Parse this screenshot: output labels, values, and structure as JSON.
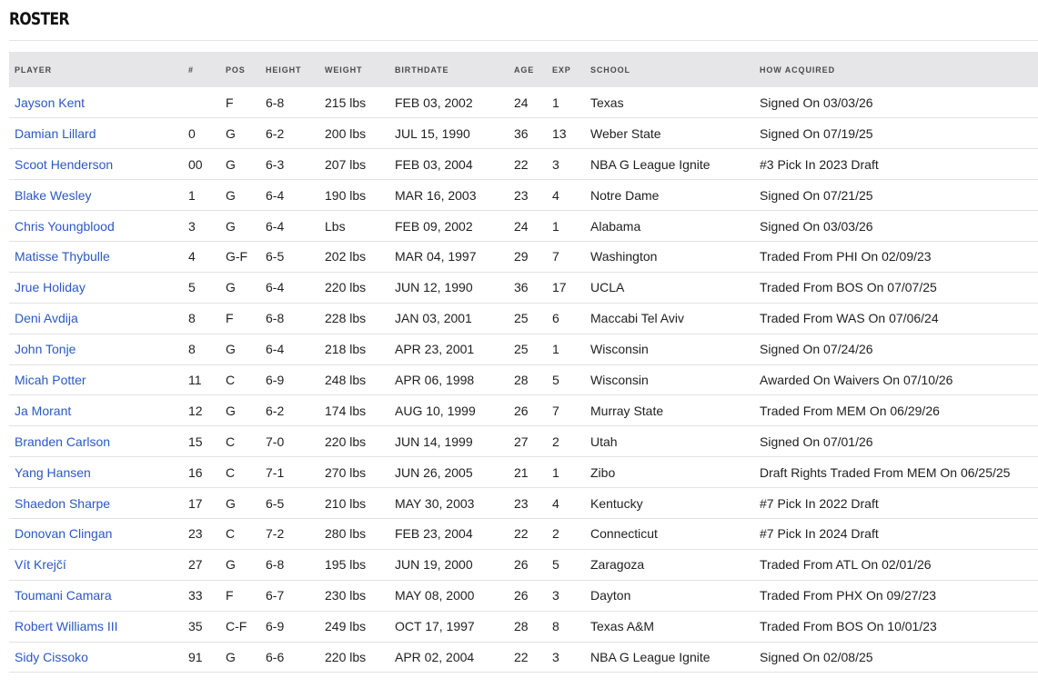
{
  "title": "ROSTER",
  "columns": {
    "player": "PLAYER",
    "number": "#",
    "pos": "POS",
    "height": "HEIGHT",
    "weight": "WEIGHT",
    "birthdate": "BIRTHDATE",
    "age": "AGE",
    "exp": "EXP",
    "school": "SCHOOL",
    "acquired": "HOW ACQUIRED"
  },
  "colors": {
    "link": "#2b58c5",
    "header_bg": "#e6e6e9",
    "divider": "#e3e3e3"
  },
  "rows": [
    {
      "player": "Jayson Kent",
      "number": "",
      "pos": "F",
      "height": "6-8",
      "weight": "215 lbs",
      "birthdate": "FEB 03, 2002",
      "age": "24",
      "exp": "1",
      "school": "Texas",
      "acquired": "Signed On 03/03/26"
    },
    {
      "player": "Damian Lillard",
      "number": "0",
      "pos": "G",
      "height": "6-2",
      "weight": "200 lbs",
      "birthdate": "JUL 15, 1990",
      "age": "36",
      "exp": "13",
      "school": "Weber State",
      "acquired": "Signed On 07/19/25"
    },
    {
      "player": "Scoot Henderson",
      "number": "00",
      "pos": "G",
      "height": "6-3",
      "weight": "207 lbs",
      "birthdate": "FEB 03, 2004",
      "age": "22",
      "exp": "3",
      "school": "NBA G League Ignite",
      "acquired": "#3 Pick In 2023 Draft"
    },
    {
      "player": "Blake Wesley",
      "number": "1",
      "pos": "G",
      "height": "6-4",
      "weight": "190 lbs",
      "birthdate": "MAR 16, 2003",
      "age": "23",
      "exp": "4",
      "school": "Notre Dame",
      "acquired": "Signed On 07/21/25"
    },
    {
      "player": "Chris Youngblood",
      "number": "3",
      "pos": "G",
      "height": "6-4",
      "weight": "Lbs",
      "birthdate": "FEB 09, 2002",
      "age": "24",
      "exp": "1",
      "school": "Alabama",
      "acquired": "Signed On 03/03/26"
    },
    {
      "player": "Matisse Thybulle",
      "number": "4",
      "pos": "G-F",
      "height": "6-5",
      "weight": "202 lbs",
      "birthdate": "MAR 04, 1997",
      "age": "29",
      "exp": "7",
      "school": "Washington",
      "acquired": "Traded From PHI On 02/09/23"
    },
    {
      "player": "Jrue Holiday",
      "number": "5",
      "pos": "G",
      "height": "6-4",
      "weight": "220 lbs",
      "birthdate": "JUN 12, 1990",
      "age": "36",
      "exp": "17",
      "school": "UCLA",
      "acquired": "Traded From BOS On 07/07/25"
    },
    {
      "player": "Deni Avdija",
      "number": "8",
      "pos": "F",
      "height": "6-8",
      "weight": "228 lbs",
      "birthdate": "JAN 03, 2001",
      "age": "25",
      "exp": "6",
      "school": "Maccabi Tel Aviv",
      "acquired": "Traded From WAS On 07/06/24"
    },
    {
      "player": "John Tonje",
      "number": "8",
      "pos": "G",
      "height": "6-4",
      "weight": "218 lbs",
      "birthdate": "APR 23, 2001",
      "age": "25",
      "exp": "1",
      "school": "Wisconsin",
      "acquired": "Signed On 07/24/26"
    },
    {
      "player": "Micah Potter",
      "number": "11",
      "pos": "C",
      "height": "6-9",
      "weight": "248 lbs",
      "birthdate": "APR 06, 1998",
      "age": "28",
      "exp": "5",
      "school": "Wisconsin",
      "acquired": "Awarded On Waivers On 07/10/26"
    },
    {
      "player": "Ja Morant",
      "number": "12",
      "pos": "G",
      "height": "6-2",
      "weight": "174 lbs",
      "birthdate": "AUG 10, 1999",
      "age": "26",
      "exp": "7",
      "school": "Murray State",
      "acquired": "Traded From MEM On 06/29/26"
    },
    {
      "player": "Branden Carlson",
      "number": "15",
      "pos": "C",
      "height": "7-0",
      "weight": "220 lbs",
      "birthdate": "JUN 14, 1999",
      "age": "27",
      "exp": "2",
      "school": "Utah",
      "acquired": "Signed On 07/01/26"
    },
    {
      "player": "Yang Hansen",
      "number": "16",
      "pos": "C",
      "height": "7-1",
      "weight": "270 lbs",
      "birthdate": "JUN 26, 2005",
      "age": "21",
      "exp": "1",
      "school": "Zibo",
      "acquired": "Draft Rights Traded From MEM On 06/25/25"
    },
    {
      "player": "Shaedon Sharpe",
      "number": "17",
      "pos": "G",
      "height": "6-5",
      "weight": "210 lbs",
      "birthdate": "MAY 30, 2003",
      "age": "23",
      "exp": "4",
      "school": "Kentucky",
      "acquired": "#7 Pick In 2022 Draft"
    },
    {
      "player": "Donovan Clingan",
      "number": "23",
      "pos": "C",
      "height": "7-2",
      "weight": "280 lbs",
      "birthdate": "FEB 23, 2004",
      "age": "22",
      "exp": "2",
      "school": "Connecticut",
      "acquired": "#7 Pick In 2024 Draft"
    },
    {
      "player": "Vít Krejčí",
      "number": "27",
      "pos": "G",
      "height": "6-8",
      "weight": "195 lbs",
      "birthdate": "JUN 19, 2000",
      "age": "26",
      "exp": "5",
      "school": "Zaragoza",
      "acquired": "Traded From ATL On 02/01/26"
    },
    {
      "player": "Toumani Camara",
      "number": "33",
      "pos": "F",
      "height": "6-7",
      "weight": "230 lbs",
      "birthdate": "MAY 08, 2000",
      "age": "26",
      "exp": "3",
      "school": "Dayton",
      "acquired": "Traded From PHX On 09/27/23"
    },
    {
      "player": "Robert Williams III",
      "number": "35",
      "pos": "C-F",
      "height": "6-9",
      "weight": "249 lbs",
      "birthdate": "OCT 17, 1997",
      "age": "28",
      "exp": "8",
      "school": "Texas A&M",
      "acquired": "Traded From BOS On 10/01/23"
    },
    {
      "player": "Sidy Cissoko",
      "number": "91",
      "pos": "G",
      "height": "6-6",
      "weight": "220 lbs",
      "birthdate": "APR 02, 2004",
      "age": "22",
      "exp": "3",
      "school": "NBA G League Ignite",
      "acquired": "Signed On 02/08/25"
    }
  ]
}
